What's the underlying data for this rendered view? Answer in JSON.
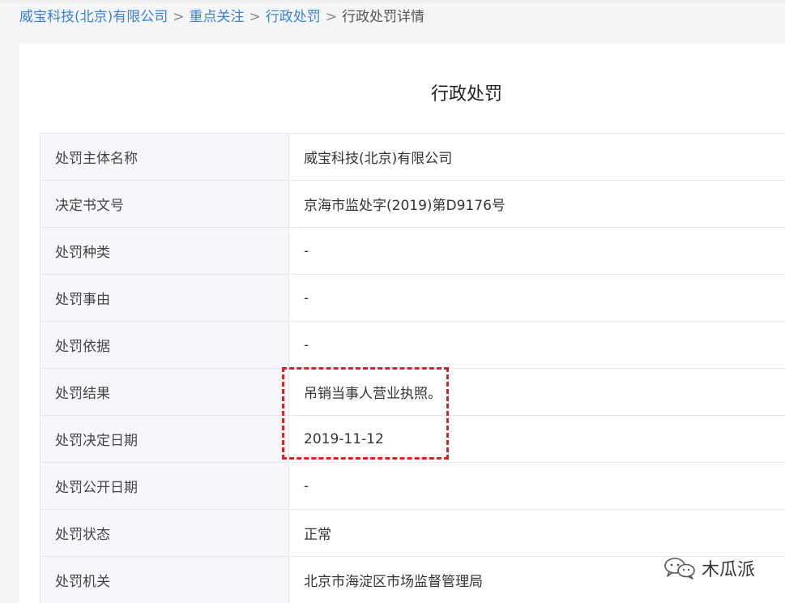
{
  "breadcrumb": {
    "company": "威宝科技(北京)有限公司",
    "focus": "重点关注",
    "penalty": "行政处罚",
    "current": "行政处罚详情",
    "separator": ">"
  },
  "card": {
    "title": "行政处罚"
  },
  "details": [
    {
      "label": "处罚主体名称",
      "value": "威宝科技(北京)有限公司"
    },
    {
      "label": "决定书文号",
      "value": "京海市监处字(2019)第D9176号"
    },
    {
      "label": "处罚种类",
      "value": "-"
    },
    {
      "label": "处罚事由",
      "value": "-"
    },
    {
      "label": "处罚依据",
      "value": "-"
    },
    {
      "label": "处罚结果",
      "value": "吊销当事人营业执照。"
    },
    {
      "label": "处罚决定日期",
      "value": "2019-11-12"
    },
    {
      "label": "处罚公开日期",
      "value": "-"
    },
    {
      "label": "处罚状态",
      "value": "正常"
    },
    {
      "label": "处罚机关",
      "value": "北京市海淀区市场监督管理局"
    }
  ],
  "watermark": {
    "text": "木瓜派",
    "icon": "wechat-icon"
  },
  "colors": {
    "link": "#3b82d6",
    "highlight_border": "#d42424",
    "label_background": "#f5f7fa",
    "border": "#e3e6eb"
  }
}
